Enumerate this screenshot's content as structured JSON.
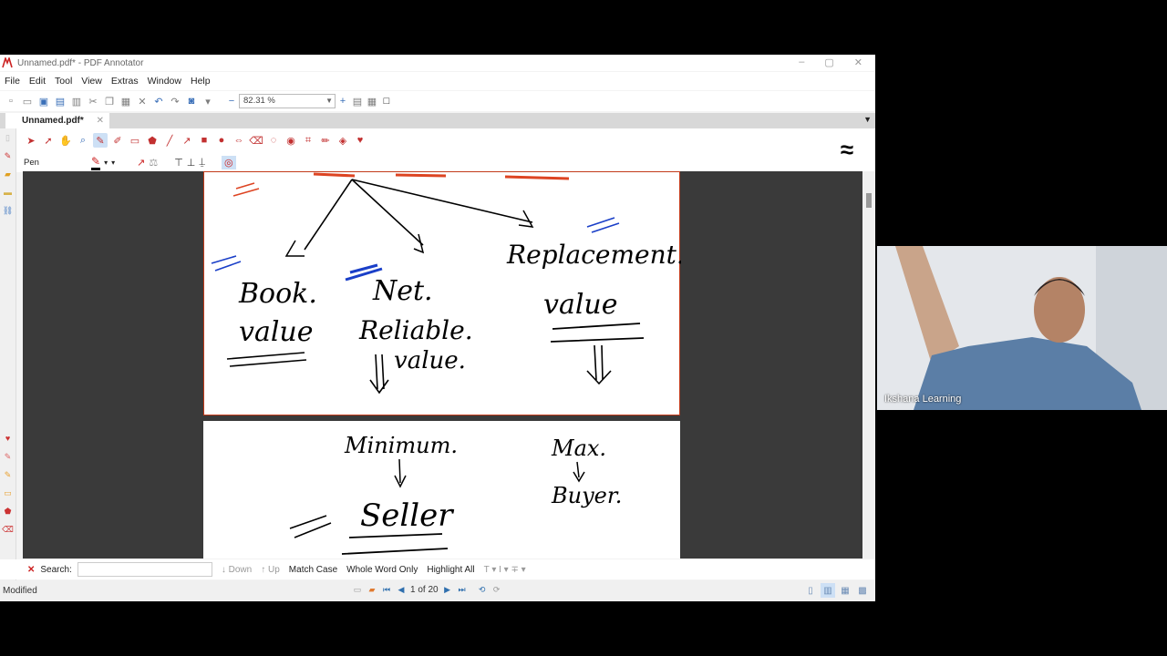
{
  "window": {
    "title": "Unnamed.pdf* - PDF Annotator",
    "controls": [
      "–",
      "▢",
      "✕"
    ]
  },
  "menu": [
    "File",
    "Edit",
    "Tool",
    "View",
    "Extras",
    "Window",
    "Help"
  ],
  "zoom": {
    "value": "82.31 %"
  },
  "tab": {
    "label": "Unnamed.pdf*",
    "close": "✕"
  },
  "tool_panel": {
    "current_tool": "Pen"
  },
  "handwriting": {
    "page1": {
      "left_top": "Book.",
      "left_bottom": "value",
      "plus": "+",
      "mid_line1": "Net.",
      "mid_line2": "Reliable.",
      "mid_line3": "value.",
      "right_top": "Replacement.",
      "right_bottom": "value"
    },
    "page2": {
      "left_top": "Minimum.",
      "left_bottom": "Seller",
      "right_top": "Max.",
      "right_bottom": "Buyer."
    }
  },
  "search": {
    "label": "Search:",
    "value": "",
    "down": "Down",
    "up": "Up",
    "match_case": "Match Case",
    "whole_word": "Whole Word Only",
    "highlight_all": "Highlight All"
  },
  "status": {
    "text": "Modified",
    "page_indicator": "1 of 20"
  },
  "webcam": {
    "label": "Ikshana Learning"
  },
  "colors": {
    "accent_red": "#c23030",
    "toolbar_blue": "#3a6fb8",
    "canvas": "#3a3a3a"
  }
}
